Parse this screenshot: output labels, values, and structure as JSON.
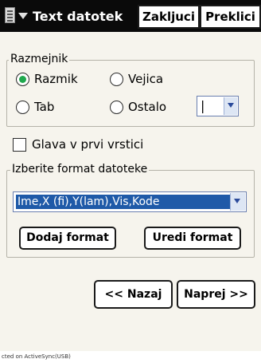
{
  "top_bar": {
    "menu_icon": "document-menu-icon",
    "title": "Text datotek",
    "buttons": {
      "finish": "Zakljuci",
      "cancel": "Preklici"
    }
  },
  "delimiter_group": {
    "title": "Razmejnik",
    "options": [
      {
        "label": "Razmik",
        "selected": true
      },
      {
        "label": "Vejica",
        "selected": false
      },
      {
        "label": "Tab",
        "selected": false
      },
      {
        "label": "Ostalo",
        "selected": false
      }
    ],
    "other_value": "|"
  },
  "header_checkbox": {
    "label": "Glava v prvi vrstici",
    "checked": false
  },
  "format_group": {
    "title": "Izberite format datoteke",
    "selected_format": "Ime,X (fi),Y(lam),Vis,Kode",
    "add_button": "Dodaj format",
    "edit_button": "Uredi format"
  },
  "navigation": {
    "back": "<< Nazaj",
    "next": "Naprej >>"
  },
  "status_text": "cted on ActiveSync(USB)",
  "colors": {
    "radio_selected": "#1fa84d",
    "selection": "#1f5aa8",
    "top_bar": "#0a0a0a"
  }
}
